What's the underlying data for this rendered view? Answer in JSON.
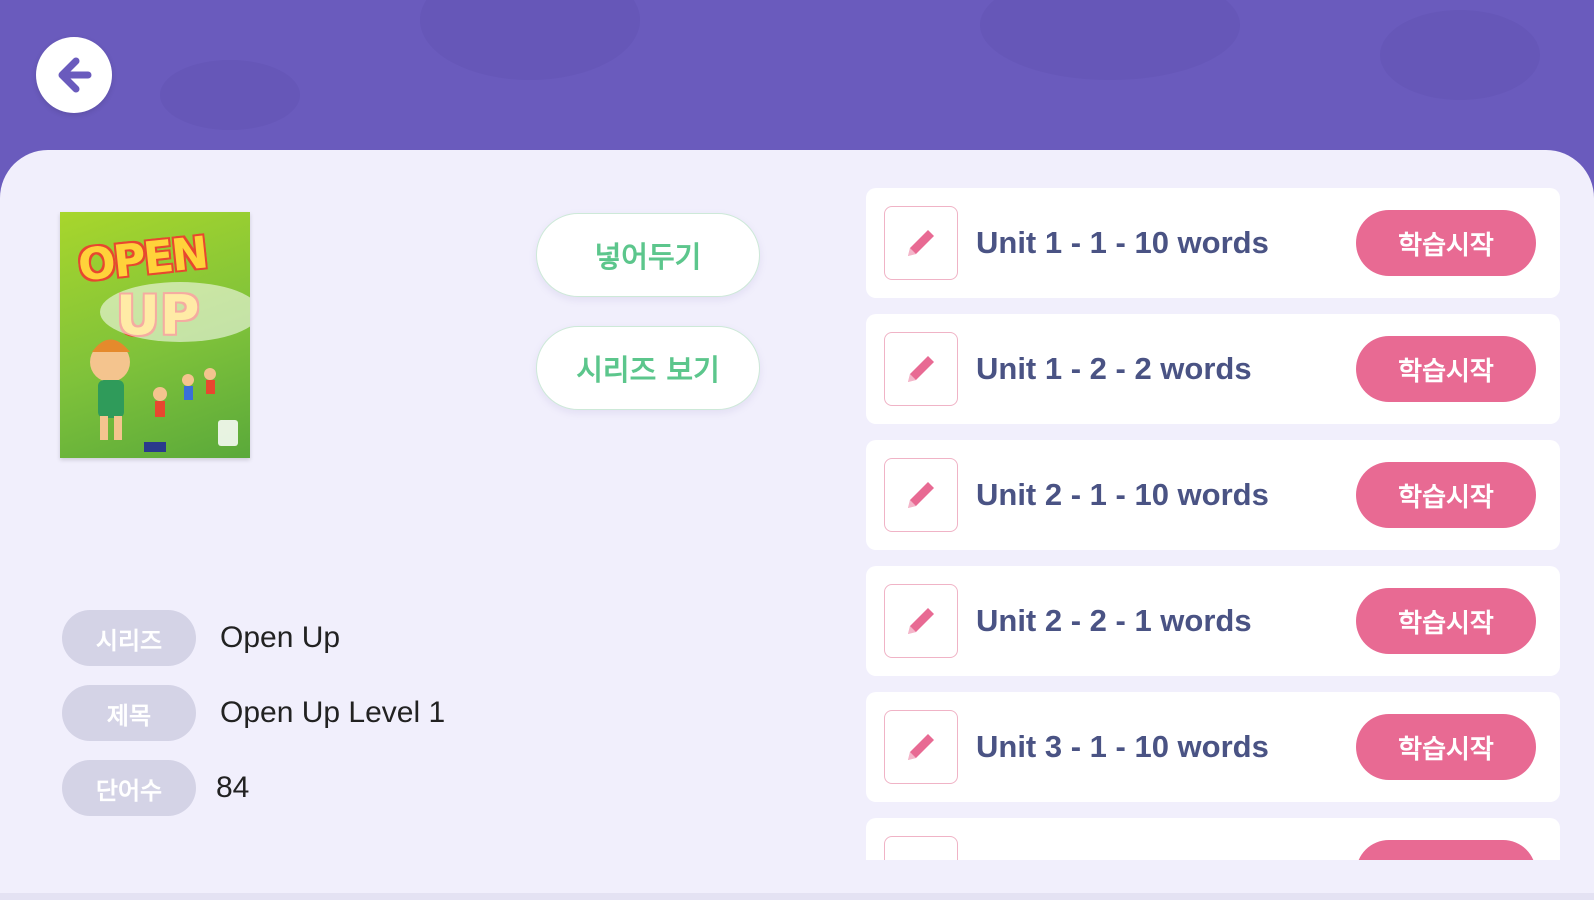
{
  "header": {
    "back_icon": "arrow-left-icon"
  },
  "book": {
    "cover_text_top": "OPEN",
    "cover_text_bottom": "UP",
    "actions": [
      "넣어두기",
      "시리즈 보기"
    ]
  },
  "info": [
    {
      "tag": "시리즈",
      "value": "Open Up"
    },
    {
      "tag": "제목",
      "value": "Open Up Level 1"
    },
    {
      "tag": "단어수",
      "value": "84"
    }
  ],
  "units": [
    {
      "label": "Unit 1 - 1 - 10 words",
      "button": "학습시작"
    },
    {
      "label": "Unit 1 - 2 - 2 words",
      "button": "학습시작"
    },
    {
      "label": "Unit 2 - 1 - 10 words",
      "button": "학습시작"
    },
    {
      "label": "Unit 2 - 2 - 1 words",
      "button": "학습시작"
    },
    {
      "label": "Unit 3 - 1 - 10 words",
      "button": "학습시작"
    },
    {
      "label": "",
      "button": ""
    }
  ],
  "colors": {
    "header": "#6a5bbd",
    "panel": "#f1effc",
    "accent_pink": "#e86a93",
    "accent_green": "#5cc68c",
    "label_navy": "#4a5384"
  }
}
